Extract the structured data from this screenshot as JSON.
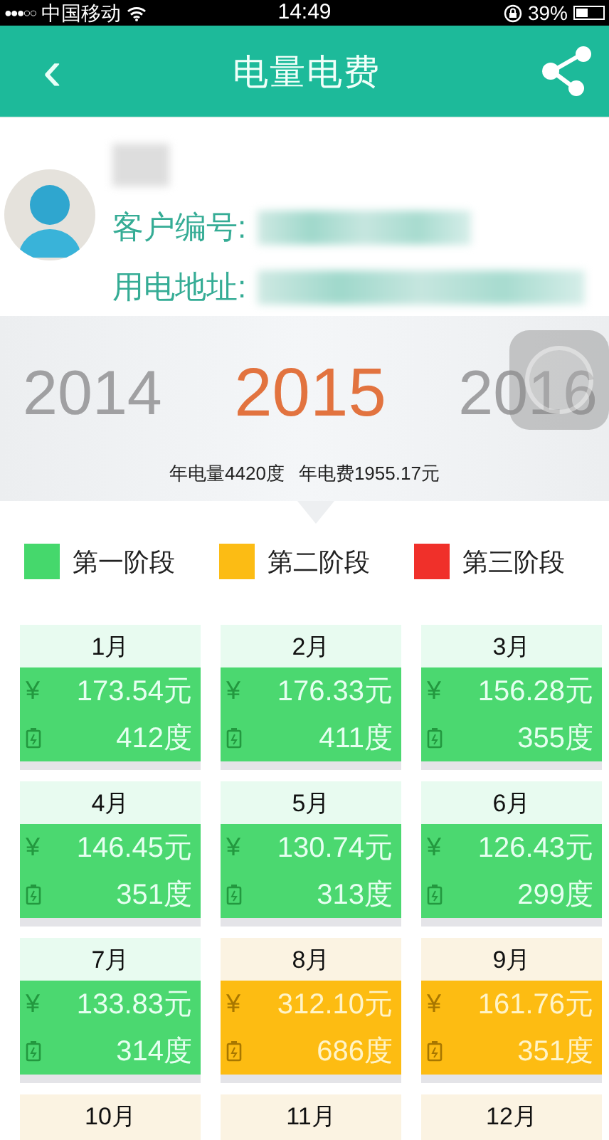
{
  "status_bar": {
    "signal": "●●●○○",
    "carrier": "中国移动",
    "time": "14:49",
    "battery": "39%"
  },
  "header": {
    "back": "‹",
    "title": "电量电费"
  },
  "profile": {
    "customer_no_label": "客户编号:",
    "address_label": "用电地址:"
  },
  "years": [
    {
      "label": "2014",
      "selected": false
    },
    {
      "label": "2015",
      "selected": true
    },
    {
      "label": "2016",
      "selected": false
    }
  ],
  "summary": [
    "年电量4420度",
    "年电费1955.17元"
  ],
  "legend": [
    {
      "label": "第一阶段",
      "color": "#45d86c"
    },
    {
      "label": "第二阶段",
      "color": "#fcbc14"
    },
    {
      "label": "第三阶段",
      "color": "#f0302a"
    }
  ],
  "months": [
    {
      "month": "1月",
      "kind": "first",
      "currency": "¥",
      "amount": "173.54元",
      "usage": "412度"
    },
    {
      "month": "2月",
      "kind": "first",
      "currency": "¥",
      "amount": "176.33元",
      "usage": "411度"
    },
    {
      "month": "3月",
      "kind": "first",
      "currency": "¥",
      "amount": "156.28元",
      "usage": "355度"
    },
    {
      "month": "4月",
      "kind": "first",
      "currency": "¥",
      "amount": "146.45元",
      "usage": "351度"
    },
    {
      "month": "5月",
      "kind": "first",
      "currency": "¥",
      "amount": "130.74元",
      "usage": "313度"
    },
    {
      "month": "6月",
      "kind": "first",
      "currency": "¥",
      "amount": "126.43元",
      "usage": "299度"
    },
    {
      "month": "7月",
      "kind": "first",
      "currency": "¥",
      "amount": "133.83元",
      "usage": "314度"
    },
    {
      "month": "8月",
      "kind": "second",
      "currency": "¥",
      "amount": "312.10元",
      "usage": "686度"
    },
    {
      "month": "9月",
      "kind": "second",
      "currency": "¥",
      "amount": "161.76元",
      "usage": "351度"
    },
    {
      "month": "10月",
      "kind": "second"
    },
    {
      "month": "11月",
      "kind": "second"
    },
    {
      "month": "12月",
      "kind": "second"
    }
  ]
}
